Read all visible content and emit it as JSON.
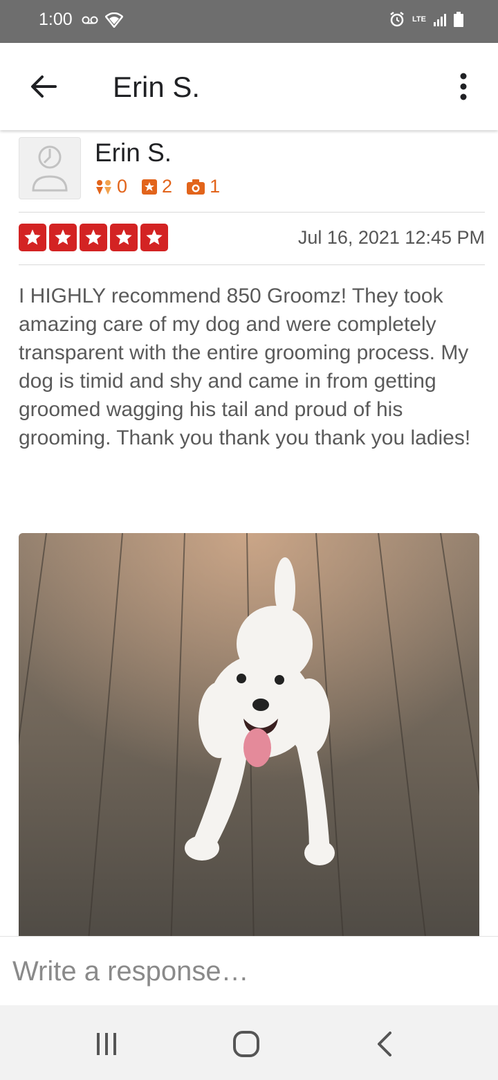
{
  "status": {
    "time": "1:00",
    "network": "LTE",
    "icons": [
      "voicemail-icon",
      "wifi-icon",
      "alarm-icon",
      "signal-icon",
      "battery-icon"
    ]
  },
  "app_bar": {
    "title": "Erin S.",
    "icons": [
      "back-arrow-icon",
      "more-vert-icon"
    ]
  },
  "reviewer": {
    "name": "Erin S.",
    "stats": {
      "friends": "0",
      "reviews": "2",
      "photos": "1"
    },
    "stat_color": "#e2641b"
  },
  "review": {
    "rating": 5,
    "rating_color": "#d32323",
    "date": "Jul 16, 2021 12:45 PM",
    "text": "I HIGHLY recommend 850 Groomz! They took amazing care of my dog and were completely transparent with the entire grooming process. My dog is timid and shy and came in from getting groomed wagging his tail and proud of his grooming. Thank you thank you thank you ladies!"
  },
  "response": {
    "placeholder": "Write a response…",
    "value": ""
  },
  "nav": {
    "icons": [
      "recent-apps-icon",
      "home-icon",
      "back-icon"
    ]
  }
}
